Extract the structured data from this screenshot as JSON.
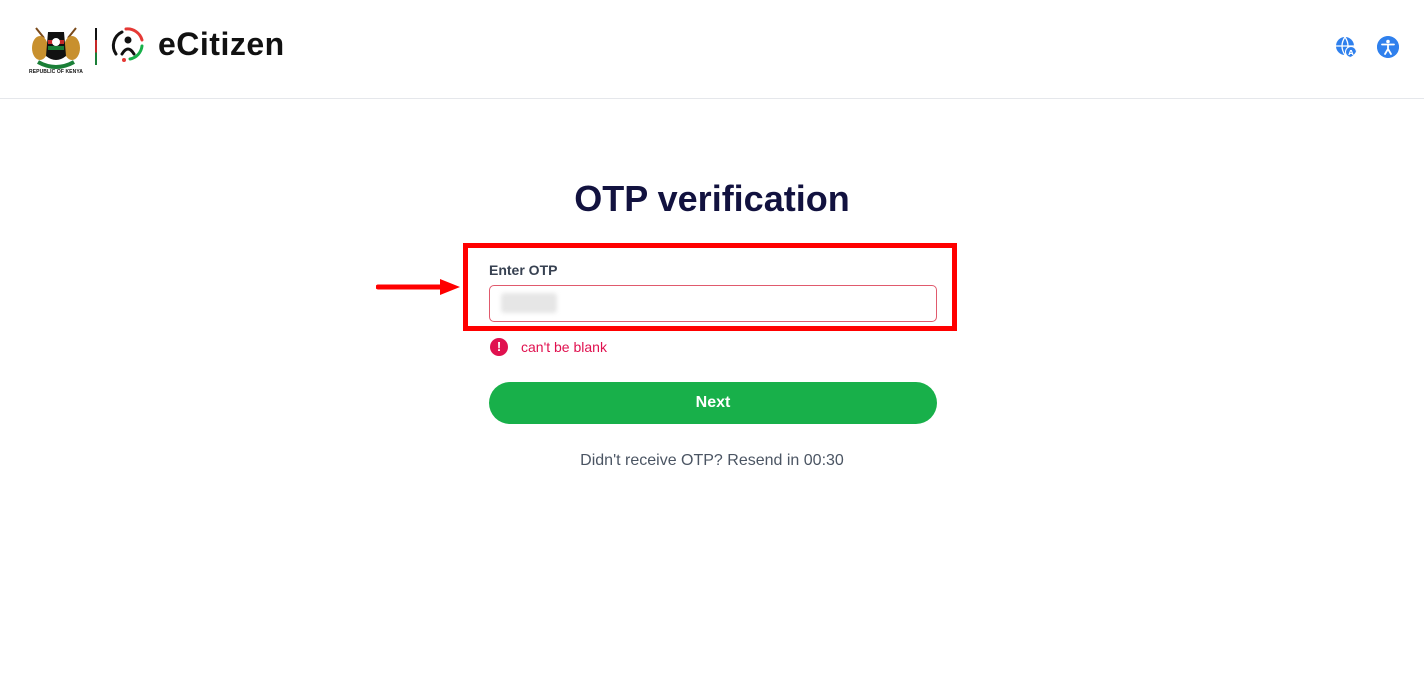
{
  "header": {
    "coat_caption": "REPUBLIC OF KENYA",
    "brand": "eCitizen",
    "icons": {
      "language": "language-icon",
      "accessibility": "accessibility-icon"
    }
  },
  "main": {
    "title": "OTP verification",
    "field_label": "Enter OTP",
    "otp_value": "",
    "error_text": "can't be blank",
    "next_label": "Next",
    "resend_prefix": "Didn't receive OTP?",
    "resend_text": "Resend in",
    "resend_timer": "00:30"
  },
  "colors": {
    "accent_green": "#18b04a",
    "error_red": "#e0114f",
    "title_navy": "#12123f",
    "annotation_red": "#ff0000"
  }
}
